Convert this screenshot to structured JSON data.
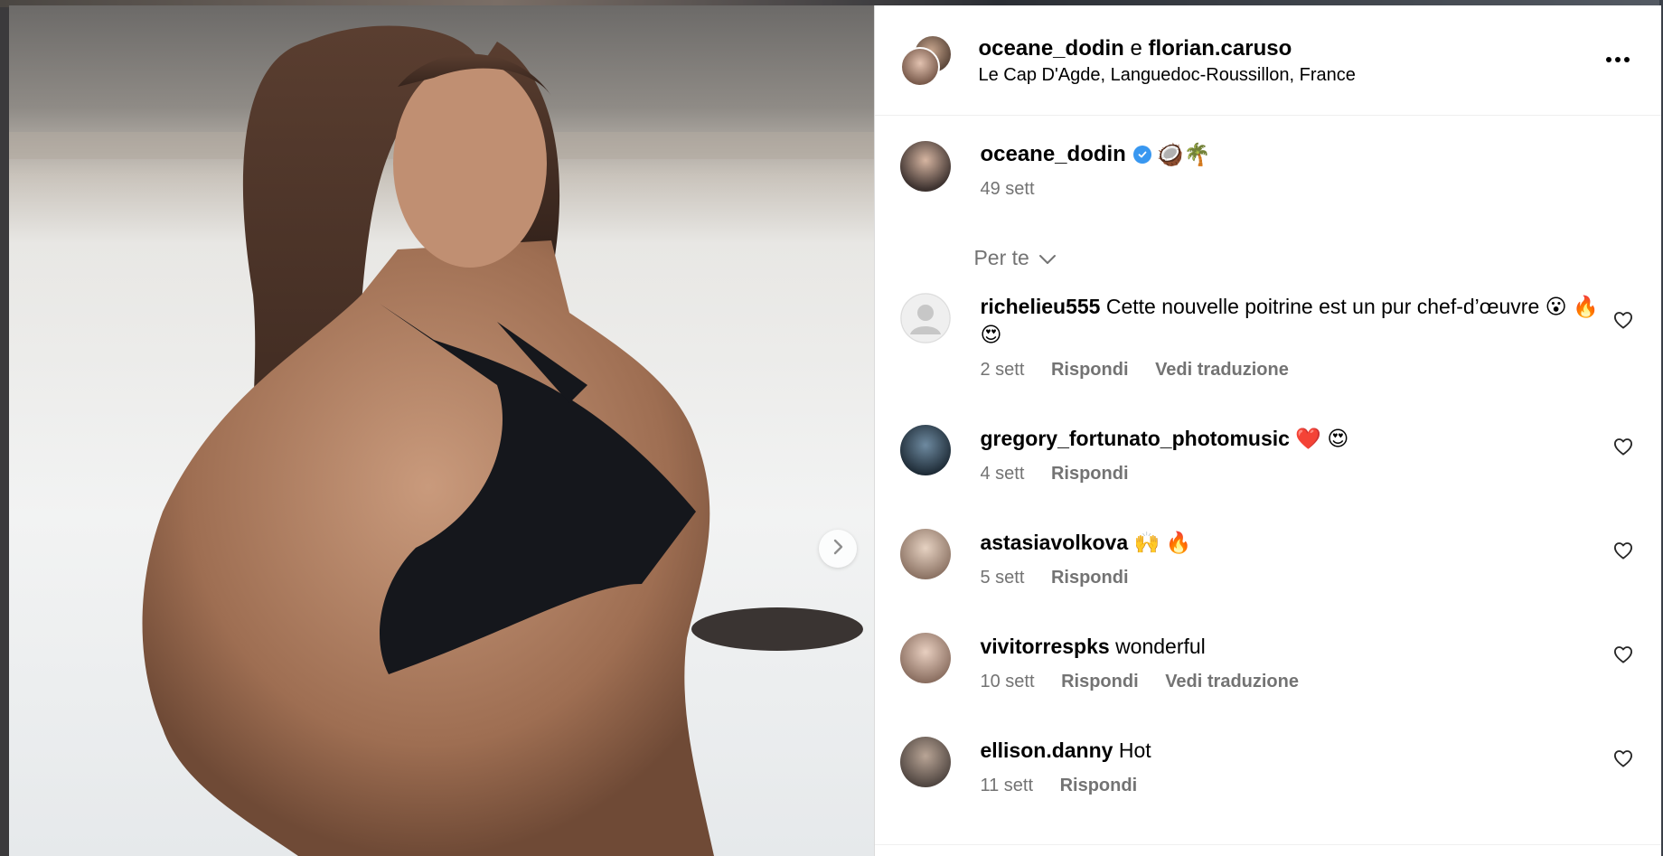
{
  "header": {
    "user1": "oceane_dodin",
    "conjunction": "e",
    "user2": "florian.caruso",
    "location": "Le Cap D'Agde, Languedoc-Roussillon, France"
  },
  "caption": {
    "username": "oceane_dodin",
    "emoji": "🥥🌴",
    "time": "49 sett"
  },
  "sort": {
    "label": "Per te"
  },
  "comments": [
    {
      "username": "richelieu555",
      "text": "Cette nouvelle poitrine est un pur chef-d’œuvre 😮 🔥 😍",
      "time": "2 sett",
      "reply": "Rispondi",
      "translate": "Vedi traduzione"
    },
    {
      "username": "gregory_fortunato_photomusic",
      "text": "❤️ 😍",
      "time": "4 sett",
      "reply": "Rispondi"
    },
    {
      "username": "astasiavolkova",
      "text": "🙌 🔥",
      "time": "5 sett",
      "reply": "Rispondi"
    },
    {
      "username": "vivitorrespks",
      "text": "wonderful",
      "time": "10 sett",
      "reply": "Rispondi",
      "translate": "Vedi traduzione"
    },
    {
      "username": "ellison.danny",
      "text": "Hot",
      "time": "11 sett",
      "reply": "Rispondi"
    }
  ],
  "icons": {
    "more": "more-options-icon",
    "next": "chevron-right-icon",
    "verified": "verified-badge-icon",
    "heart": "heart-outline-icon",
    "sort": "chevron-down-icon"
  },
  "colors": {
    "verified": "#3897f0",
    "secondary_text": "#737373",
    "divider": "#efefef"
  }
}
